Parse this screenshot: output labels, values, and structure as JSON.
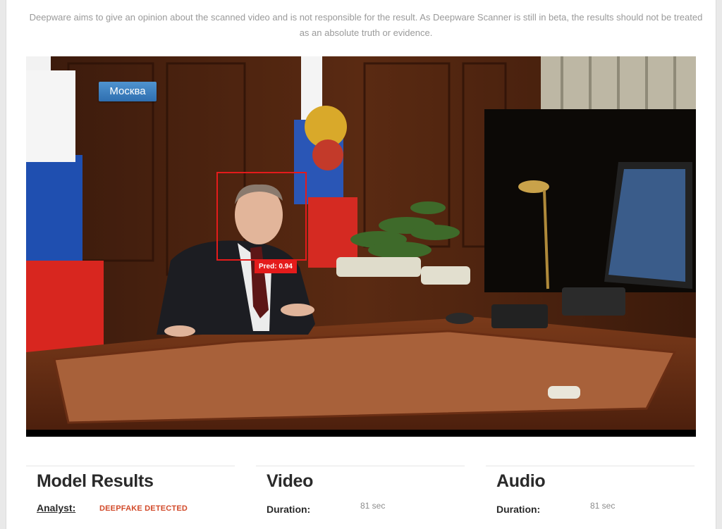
{
  "disclaimer": "Deepware aims to give an opinion about the scanned video and is not responsible for the result. As Deepware Scanner is still in beta, the results should not be treated as an absolute truth or evidence.",
  "video": {
    "channel_tag": "Москва",
    "prediction_label": "Pred: 0.94",
    "prediction_score": 0.94,
    "box_color": "#e41b1b"
  },
  "model_results": {
    "title": "Model Results",
    "analyst_label": "Analyst:",
    "analyst_value": "DEEPFAKE DETECTED",
    "status_color": "#d24a2a"
  },
  "video_info": {
    "title": "Video",
    "duration_label": "Duration:",
    "duration_value": "81 sec"
  },
  "audio_info": {
    "title": "Audio",
    "duration_label": "Duration:",
    "duration_value": "81 sec"
  }
}
